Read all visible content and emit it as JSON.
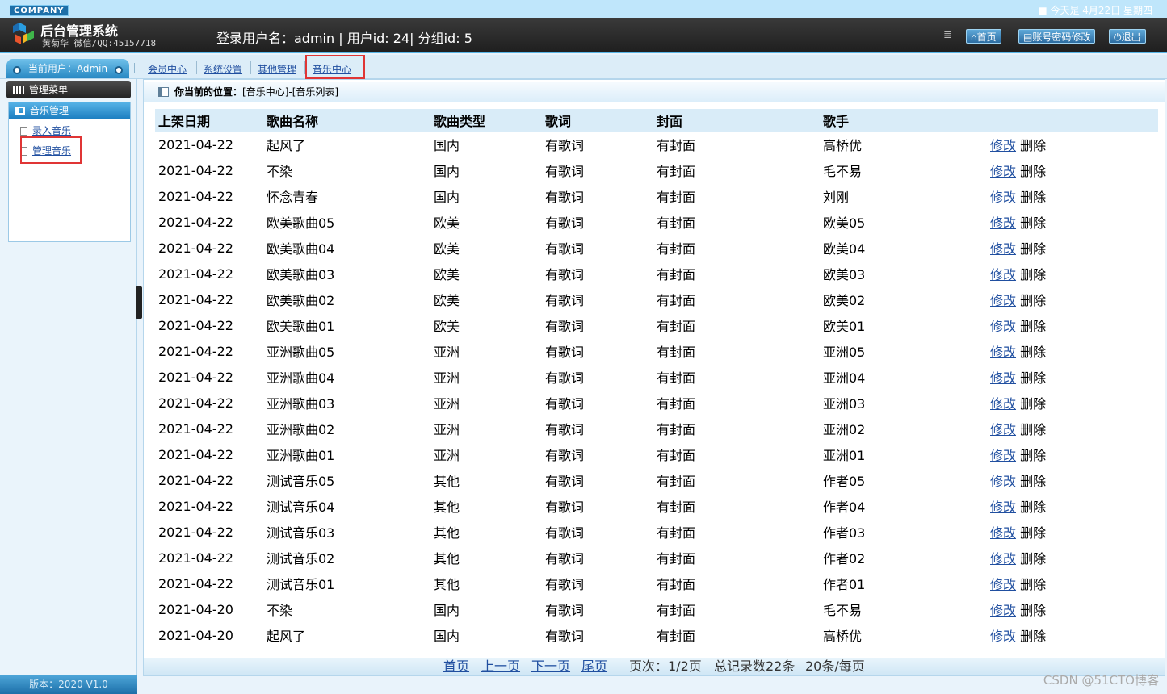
{
  "header": {
    "company_badge": "COMPANY",
    "today": "■ 今天是 4月22日  星期四",
    "title": "后台管理系统",
    "author": "黄菊华 微信/QQ:45157718",
    "login_info": "登录用户名：admin | 用户id: 24| 分组id: 5",
    "btn_home": "首页",
    "btn_pwd": "账号密码修改",
    "btn_exit": "退出"
  },
  "nav": {
    "current_user": "当前用户：Admin",
    "links": [
      "会员中心",
      "系统设置",
      "其他管理",
      "音乐中心"
    ]
  },
  "sidebar": {
    "menu_title": "管理菜单",
    "group_title": "音乐管理",
    "items": [
      "录入音乐",
      "管理音乐"
    ],
    "version": "版本：2020 V1.0"
  },
  "breadcrumb": {
    "label": "你当前的位置：",
    "path": "[音乐中心]-[音乐列表]"
  },
  "table": {
    "columns": [
      "上架日期",
      "歌曲名称",
      "歌曲类型",
      "歌词",
      "封面",
      "歌手",
      ""
    ],
    "edit_label": "修改",
    "delete_label": "删除",
    "rows": [
      [
        "2021-04-22",
        "起风了",
        "国内",
        "有歌词",
        "有封面",
        "高桥优"
      ],
      [
        "2021-04-22",
        "不染",
        "国内",
        "有歌词",
        "有封面",
        "毛不易"
      ],
      [
        "2021-04-22",
        "怀念青春",
        "国内",
        "有歌词",
        "有封面",
        "刘刚"
      ],
      [
        "2021-04-22",
        "欧美歌曲05",
        "欧美",
        "有歌词",
        "有封面",
        "欧美05"
      ],
      [
        "2021-04-22",
        "欧美歌曲04",
        "欧美",
        "有歌词",
        "有封面",
        "欧美04"
      ],
      [
        "2021-04-22",
        "欧美歌曲03",
        "欧美",
        "有歌词",
        "有封面",
        "欧美03"
      ],
      [
        "2021-04-22",
        "欧美歌曲02",
        "欧美",
        "有歌词",
        "有封面",
        "欧美02"
      ],
      [
        "2021-04-22",
        "欧美歌曲01",
        "欧美",
        "有歌词",
        "有封面",
        "欧美01"
      ],
      [
        "2021-04-22",
        "亚洲歌曲05",
        "亚洲",
        "有歌词",
        "有封面",
        "亚洲05"
      ],
      [
        "2021-04-22",
        "亚洲歌曲04",
        "亚洲",
        "有歌词",
        "有封面",
        "亚洲04"
      ],
      [
        "2021-04-22",
        "亚洲歌曲03",
        "亚洲",
        "有歌词",
        "有封面",
        "亚洲03"
      ],
      [
        "2021-04-22",
        "亚洲歌曲02",
        "亚洲",
        "有歌词",
        "有封面",
        "亚洲02"
      ],
      [
        "2021-04-22",
        "亚洲歌曲01",
        "亚洲",
        "有歌词",
        "有封面",
        "亚洲01"
      ],
      [
        "2021-04-22",
        "测试音乐05",
        "其他",
        "有歌词",
        "有封面",
        "作者05"
      ],
      [
        "2021-04-22",
        "测试音乐04",
        "其他",
        "有歌词",
        "有封面",
        "作者04"
      ],
      [
        "2021-04-22",
        "测试音乐03",
        "其他",
        "有歌词",
        "有封面",
        "作者03"
      ],
      [
        "2021-04-22",
        "测试音乐02",
        "其他",
        "有歌词",
        "有封面",
        "作者02"
      ],
      [
        "2021-04-22",
        "测试音乐01",
        "其他",
        "有歌词",
        "有封面",
        "作者01"
      ],
      [
        "2021-04-20",
        "不染",
        "国内",
        "有歌词",
        "有封面",
        "毛不易"
      ],
      [
        "2021-04-20",
        "起风了",
        "国内",
        "有歌词",
        "有封面",
        "高桥优"
      ]
    ]
  },
  "pager": {
    "first": "首页",
    "prev": "上一页",
    "next": "下一页",
    "last": "尾页",
    "page_info": "页次：1/2页",
    "total": "总记录数22条",
    "per_page": "20条/每页"
  },
  "watermark": "CSDN @51CTO博客"
}
